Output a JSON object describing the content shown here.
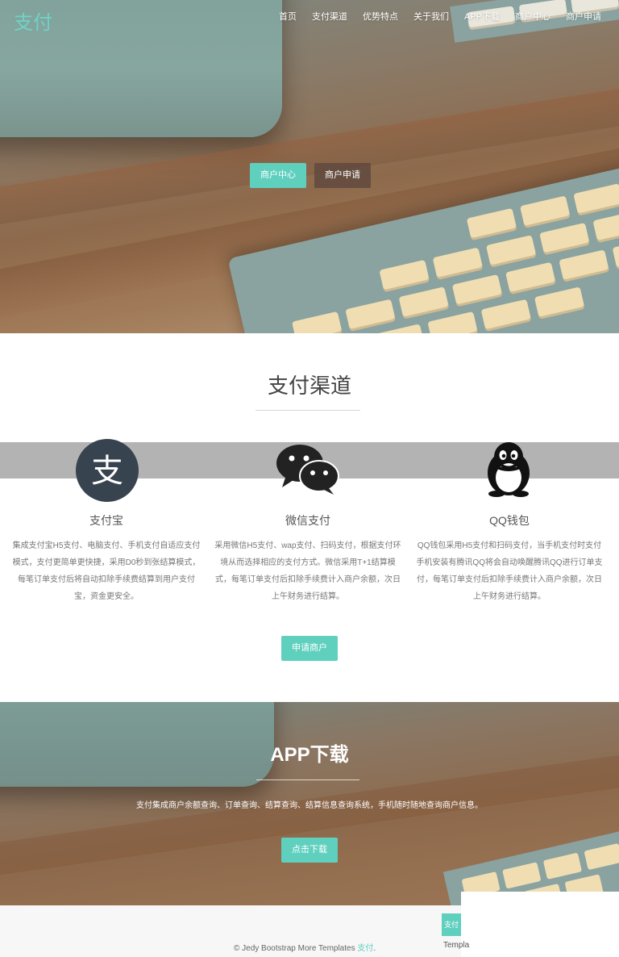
{
  "nav": {
    "brand": "支付",
    "items": [
      "首页",
      "支付渠道",
      "优势特点",
      "关于我们",
      "APP下载",
      "商户中心",
      "商户申请"
    ]
  },
  "hero": {
    "merchant_center_label": "商户中心",
    "merchant_apply_label": "商户申请"
  },
  "channels": {
    "title": "支付渠道",
    "items": [
      {
        "name": "支付宝",
        "icon": "alipay-icon",
        "desc": "集成支付宝H5支付、电脑支付、手机支付自适应支付模式，支付更简单更快捷，采用D0秒到张结算模式，每笔订单支付后将自动扣除手续费结算到用户支付宝，资金更安全。"
      },
      {
        "name": "微信支付",
        "icon": "wechat-icon",
        "desc": "采用微信H5支付、wap支付、扫码支付，根据支付环境从而选择相应的支付方式。微信采用T+1结算模式，每笔订单支付后扣除手续费计入商户余额，次日上午财务进行结算。"
      },
      {
        "name": "QQ钱包",
        "icon": "qq-penguin-icon",
        "desc": "QQ钱包采用H5支付和扫码支付，当手机支付时支付手机安装有腾讯QQ将会自动唤醒腾讯QQ进行订单支付，每笔订单支付后扣除手续费计入商户余额，次日上午财务进行结算。"
      }
    ],
    "apply_label": "申请商户"
  },
  "app": {
    "title": "APP下载",
    "text": "支付集成商户余额查询、订单查询、结算查询、结算信息查询系统，手机随时随地查询商户信息。",
    "download_label": "点击下载"
  },
  "footer": {
    "copyright": "© Jedy Bootstrap More Templates ",
    "link": "支付",
    "period": ".",
    "right_text": "Templa",
    "tag": "支付"
  },
  "colors": {
    "accent": "#5fcfbe",
    "brand": "#6fd3c6"
  }
}
